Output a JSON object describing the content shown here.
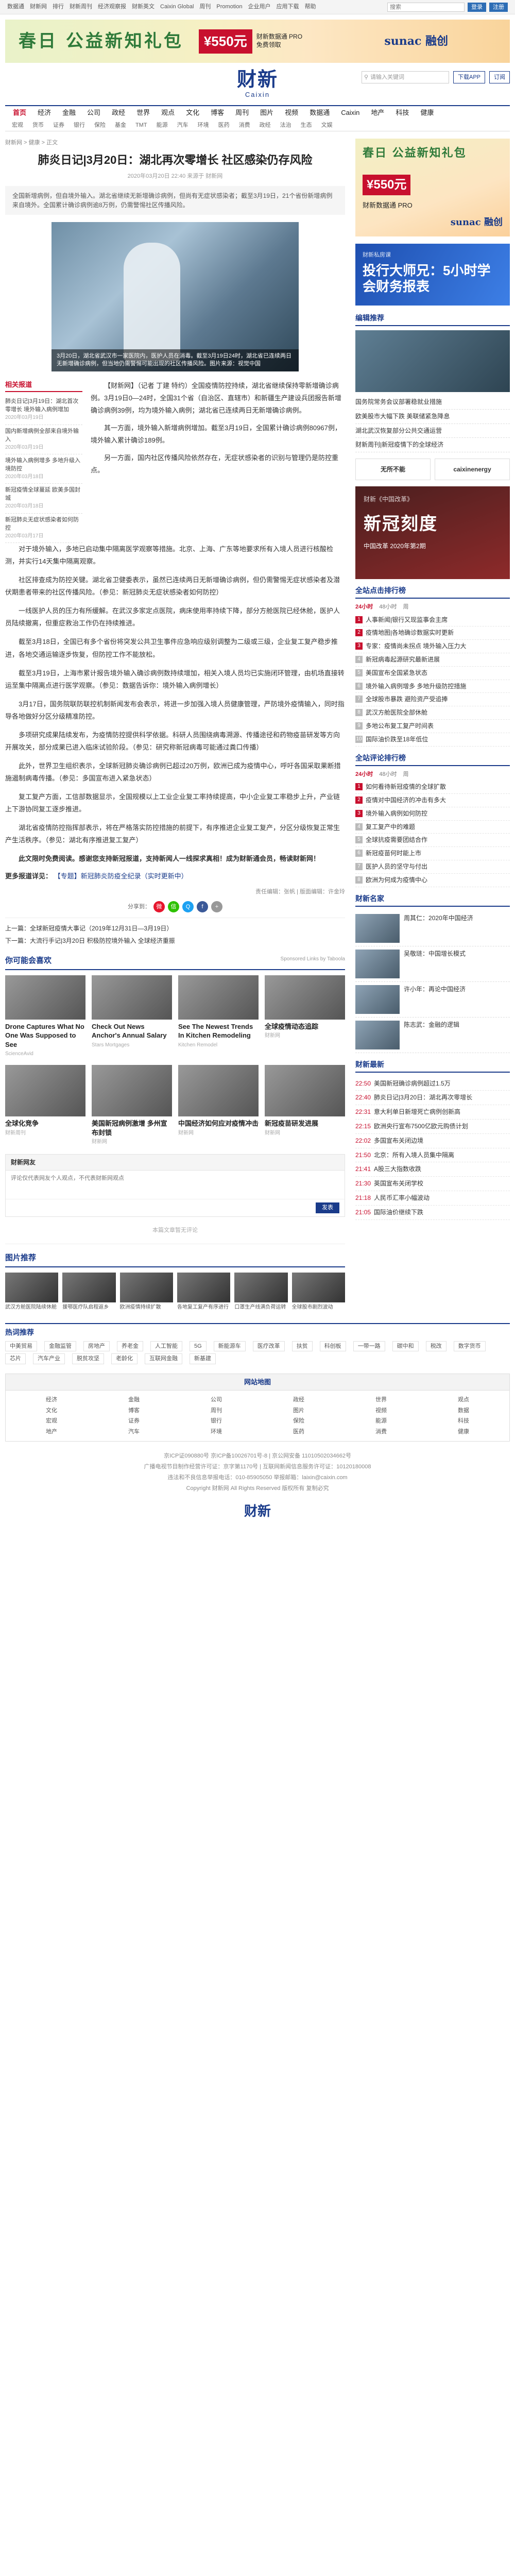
{
  "topbar": {
    "links": [
      "数据通",
      "财新网",
      "排行",
      "财新周刊",
      "经济观察报",
      "财新英文",
      "Caixin Global",
      "周刊",
      "Promotion",
      "企业用户",
      "应用下载",
      "帮助"
    ],
    "search_placeholder": "搜索",
    "login": "登录",
    "register": "注册"
  },
  "banner": {
    "title": "春日 公益新知礼包",
    "amount": "¥550元",
    "sub": "财新数据通 PRO 免费领取",
    "brand": "sunac 融创"
  },
  "masthead": {
    "logo_cn": "财新",
    "logo_en": "Caixin",
    "search_placeholder": "请输入关键词",
    "app_btn": "下载APP",
    "sub_btn": "订阅"
  },
  "nav": {
    "row1": [
      "首页",
      "经济",
      "金融",
      "公司",
      "政经",
      "世界",
      "观点",
      "文化",
      "博客",
      "周刊",
      "图片",
      "视频",
      "数据通",
      "Caixin",
      "地产",
      "科技",
      "健康"
    ],
    "row2": [
      "宏观",
      "货币",
      "证券",
      "银行",
      "保险",
      "基金",
      "TMT",
      "能源",
      "汽车",
      "环境",
      "医药",
      "消费",
      "政经",
      "法治",
      "生态",
      "文娱"
    ]
  },
  "article": {
    "breadcrumb": "财新网 > 健康 > 正文",
    "title": "肺炎日记|3月20日：湖北再次零增长 社区感染仍存风险",
    "meta": "2020年03月20日 22:40 来源于 财新网",
    "summary": "全国新增病例，但自境外输入。湖北省继续无新增确诊病例，但尚有无症状感染者；截至3月19日，21个省份新增病例来自境外。全国累计确诊病例逾8万例，仍需警惕社区传播风险。",
    "figure_caption": "3月20日，湖北省武汉市一家医院内，医护人员在消毒。截至3月19日24时，湖北省已连续两日无新增确诊病例，但当地仍需警惕可能出现的社区传播风险。图片来源：视觉中国",
    "related_title": "相关报道",
    "related": [
      {
        "text": "肺炎日记|3月19日：湖北首次零增长 境外输入病例增加",
        "date": "2020年03月19日"
      },
      {
        "text": "国内新增病例全部来自境外输入",
        "date": "2020年03月19日"
      },
      {
        "text": "境外输入病例增多 多地升级入境防控",
        "date": "2020年03月18日"
      },
      {
        "text": "新冠疫情全球蔓延 欧美多国封城",
        "date": "2020年03月18日"
      },
      {
        "text": "新冠肺炎无症状感染者如何防控",
        "date": "2020年03月17日"
      }
    ],
    "lead_paragraphs": [
      "【财新网】（记者 丁建 特约）全国疫情防控持续，湖北省继续保持零新增确诊病例。3月19日0—24时，全国31个省（自治区、直辖市）和新疆生产建设兵团报告新增确诊病例39例，均为境外输入病例；湖北省已连续两日无新增确诊病例。",
      "其一方面，境外输入新增病例增加。截至3月19日，全国累计确诊病例80967例，境外输入累计确诊189例。",
      "另一方面，国内社区传播风险依然存在，无症状感染者的识别与管理仍是防控重点。"
    ],
    "paragraphs": [
      "对于境外输入，多地已启动集中隔离医学观察等措施。北京、上海、广东等地要求所有入境人员进行核酸检测，并实行14天集中隔离观察。",
      "社区排查成为防控关键。湖北省卫健委表示，虽然已连续两日无新增确诊病例，但仍需警惕无症状感染者及潜伏期患者带来的社区传播风险。（参见：新冠肺炎无症状感染者如何防控）",
      "一线医护人员的压力有所缓解。在武汉多家定点医院，病床使用率持续下降，部分方舱医院已经休舱，医护人员陆续撤离，但重症救治工作仍在持续推进。",
      "截至3月18日，全国已有多个省份将突发公共卫生事件应急响应级别调整为二级或三级，企业复工复产稳步推进，各地交通运输逐步恢复，但防控工作不能放松。",
      "截至3月19日，上海市累计报告境外输入确诊病例数持续增加，相关入境人员均已实施闭环管理，由机场直接转运至集中隔离点进行医学观察。（参见：数据告诉你：境外输入病例增长）",
      "3月17日，国务院联防联控机制新闻发布会表示，将进一步加强入境人员健康管理，严防境外疫情输入，同时指导各地做好分区分级精准防控。",
      "多项研究成果陆续发布，为疫情防控提供科学依据。科研人员围绕病毒溯源、传播途径和药物疫苗研发等方向开展攻关，部分成果已进入临床试验阶段。（参见：研究称新冠病毒可能通过粪口传播）",
      "此外，世界卫生组织表示，全球新冠肺炎确诊病例已超过20万例，欧洲已成为疫情中心，呼吁各国采取果断措施遏制病毒传播。（参见：多国宣布进入紧急状态）",
      "复工复产方面，工信部数据显示，全国规模以上工业企业复工率持续提高，中小企业复工率稳步上升，产业链上下游协同复工逐步推进。",
      "湖北省疫情防控指挥部表示，将在严格落实防控措施的前提下，有序推进企业复工复产，分区分级恢复正常生产生活秩序。（参见：湖北有序推进复工复产）"
    ],
    "bold_paragraph": "此文限时免费阅读。感谢您支持新冠报道，支持新闻人一线探求真相！成为财新通会员，畅读财新网！",
    "more_label": "更多报道详见：",
    "more_link": "【专题】新冠肺炎防疫全纪录（实时更新中）",
    "editor": "责任编辑：张帆 | 版面编辑：许金玲",
    "share_label": "分享到：",
    "prev": "上一篇：全球新冠疫情大事记（2019年12月31日—3月19日）",
    "next": "下一篇：大流行手记|3月20日 积极防控境外输入 全球经济重振"
  },
  "recommend": {
    "heading": "你可能会喜欢",
    "sponsor": "Sponsored Links by Taboola",
    "cards": [
      {
        "title": "Drone Captures What No One Was Supposed to See",
        "src": "ScienceAvid"
      },
      {
        "title": "Check Out News Anchor's Annual Salary",
        "src": "Stars Mortgages"
      },
      {
        "title": "See The Newest Trends In Kitchen Remodeling",
        "src": "Kitchen Remodel"
      },
      {
        "title": "全球疫情动态追踪",
        "src": "财新网"
      },
      {
        "title": "全球化竞争",
        "src": "财新周刊"
      },
      {
        "title": "美国新冠病例激增 多州宣布封锁",
        "src": "财新网"
      },
      {
        "title": "中国经济如何应对疫情冲击",
        "src": "财新网"
      },
      {
        "title": "新冠疫苗研发进展",
        "src": "财新网"
      }
    ]
  },
  "comment": {
    "heading": "财新网友",
    "placeholder": "评论仅代表网友个人观点，不代表财新网观点",
    "submit": "发表",
    "empty": "本篇文章暂无评论"
  },
  "photos": {
    "heading": "图片推荐",
    "items": [
      {
        "caption": "武汉方舱医院陆续休舱"
      },
      {
        "caption": "援鄂医疗队启程返乡"
      },
      {
        "caption": "欧洲疫情持续扩散"
      },
      {
        "caption": "各地复工复产有序进行"
      },
      {
        "caption": "口罩生产线满负荷运转"
      },
      {
        "caption": "全球股市剧烈波动"
      }
    ]
  },
  "side": {
    "ad_title": "春日 公益新知礼包",
    "ad_amount": "¥550元",
    "ad_sub": "财新数据通 PRO",
    "ad_brand": "sunac 融创",
    "ad2_small": "财新私房课",
    "ad2_title": "投行大师兄：5小时学会财务报表",
    "ad2_sub": "",
    "rec_heading": "编辑推荐",
    "rec_list": [
      "国务院常务会议部署稳就业措施",
      "欧美股市大幅下跌 美联储紧急降息",
      "湖北武汉恢复部分公共交通运营",
      "财新周刊|新冠疫情下的全球经济"
    ],
    "apps": [
      "无所不能",
      "caixinenergy"
    ],
    "mag_small": "财新《中国改革》",
    "mag_title": "新冠刻度",
    "mag_sub": "中国改革 2020年第2期",
    "rank_heading": "全站点击排行榜",
    "rank_tabs": [
      "24小时",
      "48小时",
      "周"
    ],
    "rank": [
      "人事新闻|银行又现监事会主席",
      "疫情地图|各地确诊数据实时更新",
      "专家：疫情尚未拐点 境外输入压力大",
      "新冠病毒起源研究最新进展",
      "美国宣布全国紧急状态",
      "境外输入病例增多 多地升级防控措施",
      "全球股市暴跌 避险资产受追捧",
      "武汉方舱医院全部休舱",
      "多地公布复工复产时间表",
      "国际油价跌至18年低位"
    ],
    "hot_heading": "全站评论排行榜",
    "hot_tabs": [
      "24小时",
      "48小时",
      "周"
    ],
    "hot": [
      "如何看待新冠疫情的全球扩散",
      "疫情对中国经济的冲击有多大",
      "境外输入病例如何防控",
      "复工复产中的难题",
      "全球抗疫需要团结合作",
      "新冠疫苗何时能上市",
      "医护人员的坚守与付出",
      "欧洲为何成为疫情中心"
    ],
    "biz_heading": "财新名家",
    "biz": [
      {
        "text": "周其仁：2020年中国经济"
      },
      {
        "text": "吴敬琏：中国增长模式"
      },
      {
        "text": "许小年：再论中国经济"
      },
      {
        "text": "陈志武：金融的逻辑"
      }
    ],
    "timeline_heading": "财新最新",
    "timeline": [
      {
        "time": "22:50",
        "text": "美国新冠确诊病例超过1.5万"
      },
      {
        "time": "22:40",
        "text": "肺炎日记|3月20日：湖北再次零增长"
      },
      {
        "time": "22:31",
        "text": "意大利单日新增死亡病例创新高"
      },
      {
        "time": "22:15",
        "text": "欧洲央行宣布7500亿欧元购债计划"
      },
      {
        "time": "22:02",
        "text": "多国宣布关闭边境"
      },
      {
        "time": "21:50",
        "text": "北京：所有入境人员集中隔离"
      },
      {
        "time": "21:41",
        "text": "A股三大指数收跌"
      },
      {
        "time": "21:30",
        "text": "英国宣布关闭学校"
      },
      {
        "time": "21:18",
        "text": "人民币汇率小幅波动"
      },
      {
        "time": "21:05",
        "text": "国际油价继续下跌"
      }
    ]
  },
  "footer": {
    "links_heading": "热词推荐",
    "links": [
      "中美贸易",
      "金融监管",
      "房地产",
      "养老金",
      "人工智能",
      "5G",
      "新能源车",
      "医疗改革",
      "扶贫",
      "科创板",
      "一带一路",
      "碳中和",
      "税改",
      "数字货币",
      "芯片",
      "汽车产业",
      "脱贫攻坚",
      "老龄化",
      "互联网金融",
      "新基建"
    ],
    "sitenav_heading": "网站地图",
    "sitenav": [
      "经济",
      "金融",
      "公司",
      "政经",
      "世界",
      "观点",
      "文化",
      "博客",
      "周刊",
      "图片",
      "视频",
      "数据",
      "宏观",
      "证券",
      "银行",
      "保险",
      "能源",
      "科技",
      "地产",
      "汽车",
      "环境",
      "医药",
      "消费",
      "健康"
    ],
    "copyright_lines": [
      "京ICP证090880号 京ICP备10026701号-8 | 京公网安备 11010502034662号",
      "广播电视节目制作经营许可证：京字第1170号 | 互联网新闻信息服务许可证：10120180008",
      "违法和不良信息举报电话：010-85905050 举报邮箱：laixin@caixin.com",
      "Copyright 财新网 All Rights Reserved 版权所有 复制必究"
    ],
    "logo": "财新"
  },
  "colors": {
    "brand": "#1a3b8a",
    "accent": "#c8102e"
  }
}
